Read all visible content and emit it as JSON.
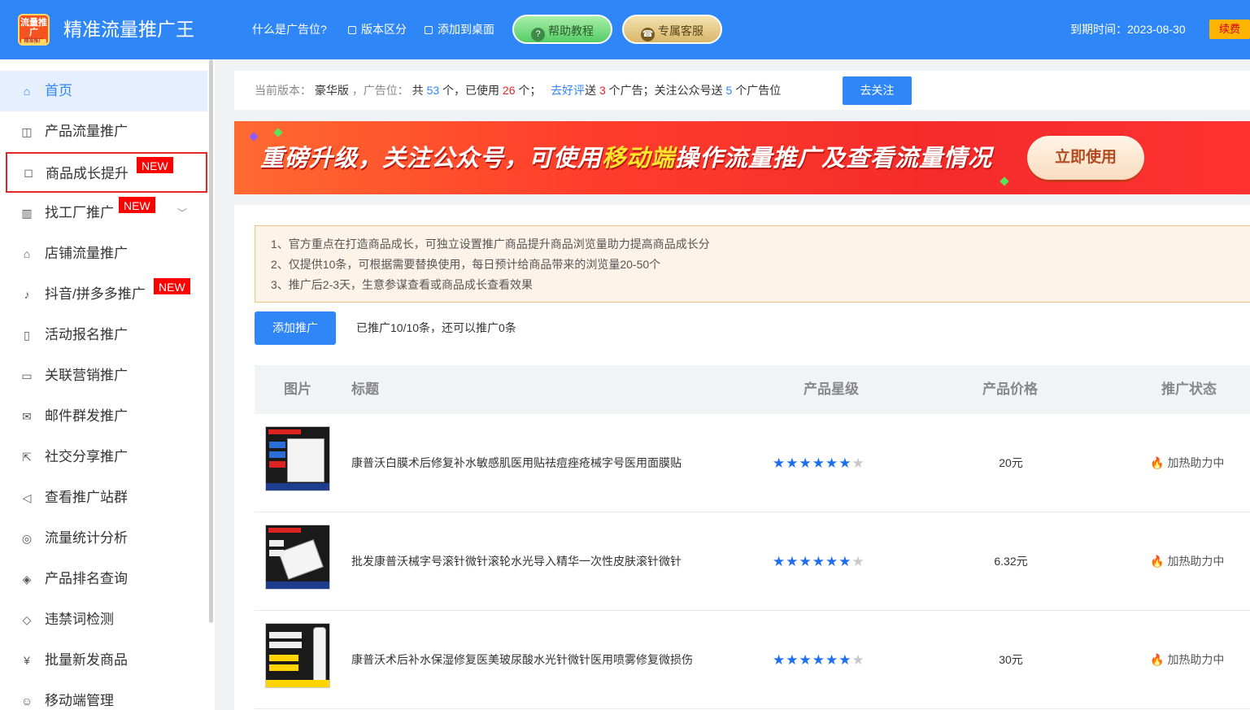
{
  "header": {
    "logo_text": "流量推广",
    "logo_sub": "精准推广",
    "app_title": "精准流量推广王",
    "links": [
      "什么是广告位?",
      "版本区分",
      "添加到桌面"
    ],
    "help_button": "帮助教程",
    "service_button": "专属客服",
    "expire_label": "到期时间：2023-08-30",
    "renew_button": "续费"
  },
  "sidebar": {
    "items": [
      {
        "label": "首页",
        "icon": "home-icon"
      },
      {
        "label": "产品流量推广",
        "icon": "bag-icon"
      },
      {
        "label": "商品成长提升",
        "icon": "briefcase-icon",
        "tag": "NEW"
      },
      {
        "label": "找工厂推广",
        "icon": "building-icon",
        "tag": "NEW"
      },
      {
        "label": "店铺流量推广",
        "icon": "store-icon"
      },
      {
        "label": "抖音/拼多多推广",
        "icon": "tiktok-icon",
        "tag": "NEW"
      },
      {
        "label": "活动报名推广",
        "icon": "phone-icon"
      },
      {
        "label": "关联营销推广",
        "icon": "chart-icon"
      },
      {
        "label": "邮件群发推广",
        "icon": "mail-icon"
      },
      {
        "label": "社交分享推广",
        "icon": "share-icon"
      },
      {
        "label": "查看推广站群",
        "icon": "megaphone-icon"
      },
      {
        "label": "流量统计分析",
        "icon": "stats-icon"
      },
      {
        "label": "产品排名查询",
        "icon": "shield-icon"
      },
      {
        "label": "违禁词检测",
        "icon": "shield-check-icon"
      },
      {
        "label": "批量新发商品",
        "icon": "yen-icon"
      },
      {
        "label": "移动端管理",
        "icon": "user-icon"
      }
    ]
  },
  "info_bar": {
    "version_label": "当前版本：",
    "version_value": "豪华版",
    "ad_label": "，广告位：",
    "total_prefix": "共",
    "total": "53",
    "used_prefix": "个，已使用",
    "used": "26",
    "used_suffix": "个；",
    "review_link": "去好评",
    "review_text": "送",
    "review_count": "3",
    "review_suffix": "个广告；关注公众号送",
    "follow_count": "5",
    "follow_suffix": "个广告位",
    "follow_button": "去关注"
  },
  "banner": {
    "text_before": "重磅升级，关注公众号，可使用",
    "text_highlight": "移动端",
    "text_after": "操作流量推广及查看流量情况",
    "button": "立即使用"
  },
  "notice": [
    "1、官方重点在打造商品成长，可独立设置推广商品提升商品浏览量助力提高商品成长分",
    "2、仅提供10条，可根据需要替换使用，每日预计给商品带来的浏览量20-50个",
    "3、推广后2-3天，生意参谋查看或商品成长查看效果"
  ],
  "add_button": "添加推广",
  "add_info": "已推广10/10条，还可以推广0条",
  "table": {
    "headers": [
      "图片",
      "标题",
      "产品星级",
      "产品价格",
      "推广状态"
    ],
    "rows": [
      {
        "title": "康普沃白膜术后修复补水敏感肌医用贴祛痘痤疮械字号医用面膜贴",
        "stars": 6,
        "max_stars": 7,
        "price": "20元",
        "status": "加热助力中"
      },
      {
        "title": "批发康普沃械字号滚针微针滚轮水光导入精华一次性皮肤滚针微针",
        "stars": 6,
        "max_stars": 7,
        "price": "6.32元",
        "status": "加热助力中"
      },
      {
        "title": "康普沃术后补水保湿修复医美玻尿酸水光针微针医用喷雾修复微损伤",
        "stars": 6,
        "max_stars": 7,
        "price": "30元",
        "status": "加热助力中"
      }
    ]
  },
  "colors": {
    "primary": "#2f86f6",
    "danger": "#e5262b",
    "star": "#1e6ff0"
  }
}
